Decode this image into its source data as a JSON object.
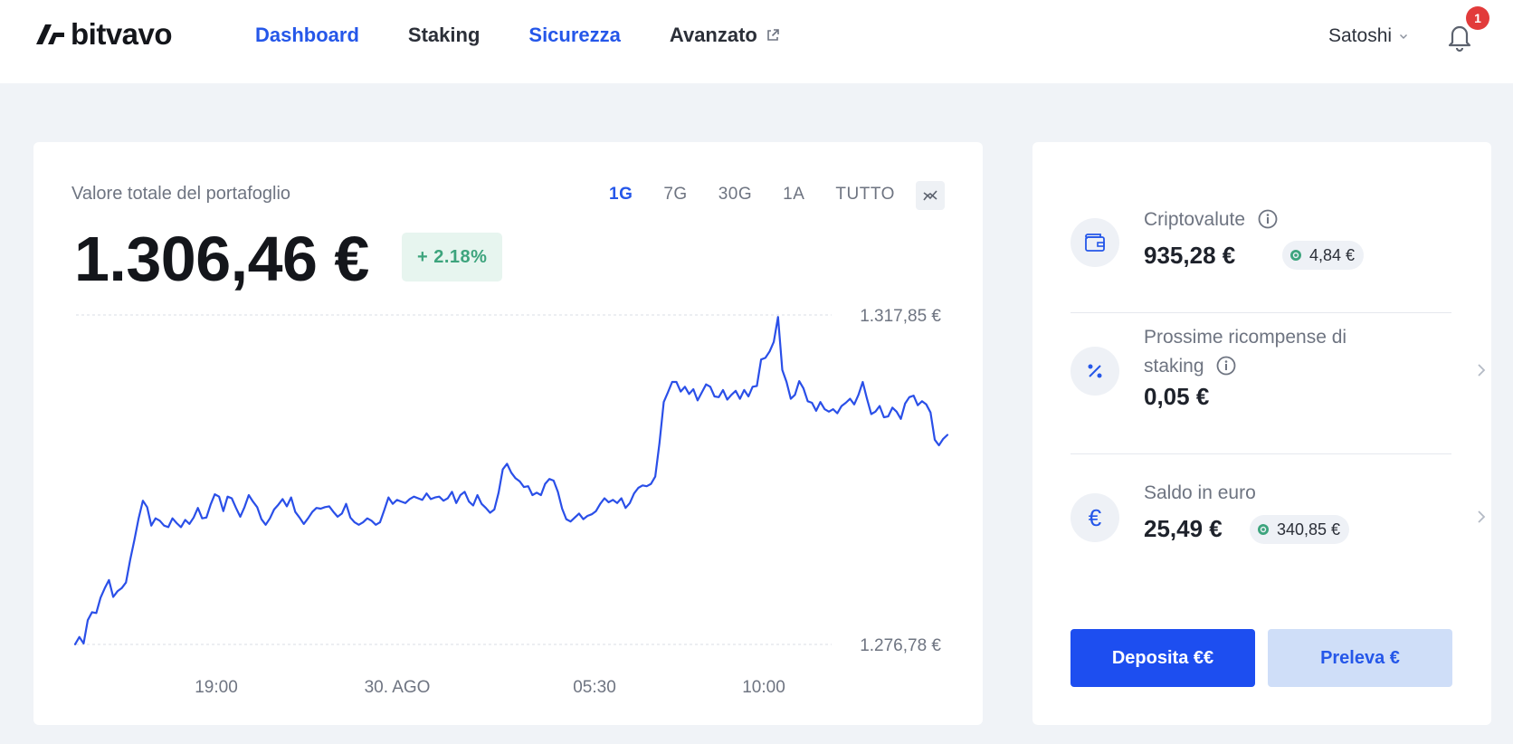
{
  "header": {
    "logo_text": "bitvavo",
    "nav": [
      {
        "label": "Dashboard",
        "active": true
      },
      {
        "label": "Staking",
        "active": false
      },
      {
        "label": "Sicurezza",
        "active": true
      },
      {
        "label": "Avanzato",
        "active": false,
        "external": true
      }
    ],
    "user_name": "Satoshi",
    "notification_count": "1"
  },
  "portfolio": {
    "label": "Valore totale del portafoglio",
    "total_value": "1.306,46 €",
    "change": "+ 2.18%",
    "ranges": [
      {
        "label": "1G",
        "active": true
      },
      {
        "label": "7G",
        "active": false
      },
      {
        "label": "30G",
        "active": false
      },
      {
        "label": "1A",
        "active": false
      },
      {
        "label": "TUTTO",
        "active": false
      }
    ],
    "compare_icon": "compare-chart-icon"
  },
  "chart_data": {
    "type": "line",
    "series": [
      {
        "values": [
          1276.8,
          1277.7,
          1276.9,
          1279.8,
          1280.8,
          1280.7,
          1282.6,
          1283.8,
          1284.8,
          1282.7,
          1283.4,
          1283.8,
          1284.5,
          1287.3,
          1289.8,
          1292.5,
          1294.7,
          1293.9,
          1291.6,
          1292.5,
          1292.2,
          1291.6,
          1291.4,
          1292.5,
          1291.9,
          1291.4,
          1292.3,
          1291.8,
          1292.6,
          1293.8,
          1292.5,
          1292.6,
          1294.2,
          1295.5,
          1295.2,
          1293.4,
          1295.2,
          1295.0,
          1293.8,
          1292.7,
          1293.9,
          1295.4,
          1294.6,
          1293.9,
          1292.4,
          1291.7,
          1292.5,
          1293.6,
          1294.2,
          1294.9,
          1294.0,
          1295.1,
          1293.3,
          1292.6,
          1291.8,
          1292.5,
          1293.3,
          1293.8,
          1293.7,
          1293.9,
          1294.0,
          1293.3,
          1292.7,
          1293.1,
          1294.3,
          1292.6,
          1292.0,
          1291.7,
          1292.0,
          1292.5,
          1292.2,
          1291.7,
          1292.0,
          1293.5,
          1295.1,
          1294.3,
          1294.8,
          1294.6,
          1294.4,
          1294.9,
          1295.2,
          1295.0,
          1294.8,
          1295.6,
          1294.9,
          1295.1,
          1295.2,
          1294.7,
          1295.0,
          1295.8,
          1294.4,
          1295.4,
          1295.8,
          1294.6,
          1294.1,
          1295.4,
          1294.3,
          1293.8,
          1293.2,
          1293.6,
          1295.7,
          1298.6,
          1299.3,
          1298.2,
          1297.5,
          1297.1,
          1296.4,
          1296.5,
          1295.4,
          1295.7,
          1295.4,
          1296.8,
          1297.4,
          1297.2,
          1295.8,
          1293.7,
          1292.4,
          1292.1,
          1292.6,
          1293.1,
          1292.4,
          1292.8,
          1293.0,
          1293.4,
          1294.3,
          1295.0,
          1294.5,
          1294.8,
          1294.4,
          1295.0,
          1293.8,
          1294.4,
          1295.6,
          1296.3,
          1296.6,
          1296.5,
          1296.8,
          1297.7,
          1301.9,
          1307.0,
          1308.2,
          1309.5,
          1309.5,
          1308.3,
          1308.9,
          1308.0,
          1308.6,
          1307.2,
          1308.2,
          1309.2,
          1308.9,
          1307.7,
          1307.6,
          1308.5,
          1307.3,
          1307.9,
          1308.4,
          1307.4,
          1308.5,
          1307.7,
          1308.9,
          1309.0,
          1312.3,
          1312.5,
          1313.3,
          1314.5,
          1317.6,
          1311.0,
          1309.5,
          1307.4,
          1307.9,
          1309.6,
          1308.7,
          1307.1,
          1306.9,
          1305.9,
          1307.0,
          1306.1,
          1305.8,
          1306.1,
          1305.6,
          1306.5,
          1306.9,
          1307.4,
          1306.7,
          1307.9,
          1309.5,
          1307.4,
          1305.5,
          1305.8,
          1306.5,
          1305.1,
          1305.2,
          1306.3,
          1305.8,
          1304.9,
          1306.8,
          1307.6,
          1307.8,
          1306.6,
          1307.1,
          1306.7,
          1305.7,
          1302.3,
          1301.6,
          1302.4,
          1302.9
        ]
      }
    ],
    "x_ticks": [
      "19:00",
      "30. AGO",
      "05:30",
      "10:00"
    ],
    "y_ticks": [
      "1.317,85 €",
      "1.276,78 €"
    ],
    "ylim": [
      1276.78,
      1317.85
    ],
    "grid": "dashed horizontal at max and min",
    "color": "#2a4fe8"
  },
  "balances": {
    "crypto": {
      "label": "Criptovalute",
      "value": "935,28 €",
      "pill": "4,84 €",
      "icon": "wallet-icon"
    },
    "staking": {
      "label": "Prossime ricompense di staking",
      "value": "0,05 €",
      "icon": "percent-icon"
    },
    "euro": {
      "label": "Saldo in euro",
      "value": "25,49 €",
      "pill": "340,85 €",
      "icon": "euro-icon",
      "icon_glyph": "€"
    }
  },
  "actions": {
    "deposit": "Deposita €€",
    "withdraw": "Preleva €"
  },
  "colors": {
    "accent": "#2557e9",
    "positive": "#3da47d",
    "badge": "#e23b3b"
  }
}
